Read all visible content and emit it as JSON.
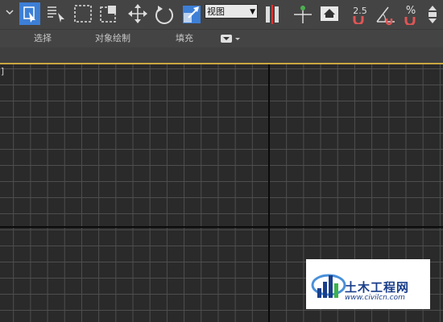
{
  "toolbar": {
    "view_dropdown": {
      "value": "视图"
    },
    "snap_angle_value": "2.5",
    "percent_snap": "%"
  },
  "ribbon": {
    "tabs": [
      {
        "label": "选择"
      },
      {
        "label": "对象绘制"
      },
      {
        "label": "填充"
      }
    ]
  },
  "viewport": {
    "label": "]"
  },
  "watermark": {
    "name": "土木工程网",
    "url": "www.civilcn.com"
  },
  "colors": {
    "accent_selected": "#3d7fd6",
    "viewport_border": "#c9a640",
    "watermark_blue": "#1a3e8a"
  }
}
